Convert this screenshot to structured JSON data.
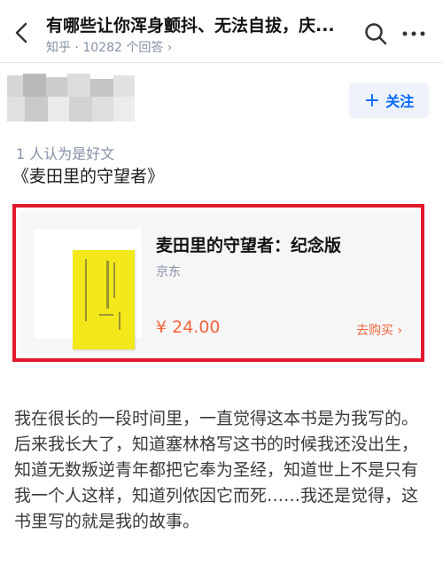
{
  "header": {
    "title": "有哪些让你浑身颤抖、无法自拔，庆...",
    "subtitle": "知乎 · 10282 个回答 ›",
    "back_icon": "chevron-left-icon",
    "search_icon": "search-icon",
    "more_icon": "more-horizontal-icon"
  },
  "author": {
    "follow_label": "关注",
    "follow_icon": "plus-icon"
  },
  "answer": {
    "likes_text": "1 人认为是好文",
    "title": "《麦田里的守望者》",
    "body": [
      "我在很长的一段时间里，一直觉得这本书是为我写的。",
      "后来我长大了，知道塞林格写这书的时候我还没出生，知道无数叛逆青年都把它奉为圣经，知道世上不是只有我一个人这样，知道列侬因它而死……我还是觉得，这书里写的就是我的故事。"
    ]
  },
  "product": {
    "name": "麦田里的守望者：纪念版",
    "seller": "京东",
    "price": "¥ 24.00",
    "buy_label": "去购买 ›"
  },
  "colors": {
    "accent": "#0066ff",
    "price": "#f1653d",
    "highlight_border": "#e2192c",
    "book_cover": "#f3e81a"
  }
}
